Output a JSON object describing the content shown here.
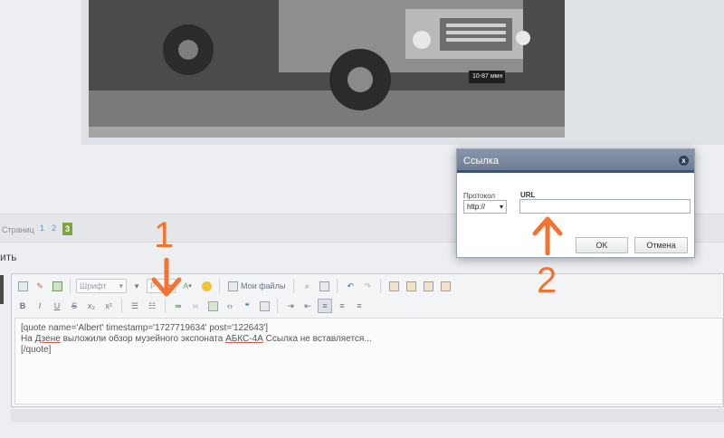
{
  "photo": {
    "plate_text": "10-87 ммн"
  },
  "pagination": {
    "label": "Страниц",
    "pages": [
      "1",
      "2",
      "3"
    ],
    "active": "3"
  },
  "reply": {
    "title": "ить"
  },
  "toolbar": {
    "font_select": "Шрифт",
    "size_select": "Р",
    "my_files": "Мои файлы",
    "bold": "B",
    "italic": "I",
    "underline": "U",
    "strike": "S",
    "sub": "x₂",
    "sup": "x²"
  },
  "editor": {
    "line1": "[quote name='Albert' timestamp='1727719634' post='122643']",
    "line2_prefix": "На ",
    "line2_word1": "Дзене",
    "line2_mid": " выложили обзор музейного экспоната ",
    "line2_word2": "АБКС-4А",
    "line2_suffix": " Ссылка не вставляется...",
    "line3": "[/quote]"
  },
  "dialog": {
    "title": "Ссылка",
    "close": "x",
    "protocol_label": "Протокол",
    "protocol_value": "http://",
    "url_label": "URL",
    "url_value": "",
    "ok_label": "OK",
    "cancel_label": "Отмена"
  },
  "annotations": {
    "one": "1",
    "two": "2",
    "color": "#f4732f"
  }
}
